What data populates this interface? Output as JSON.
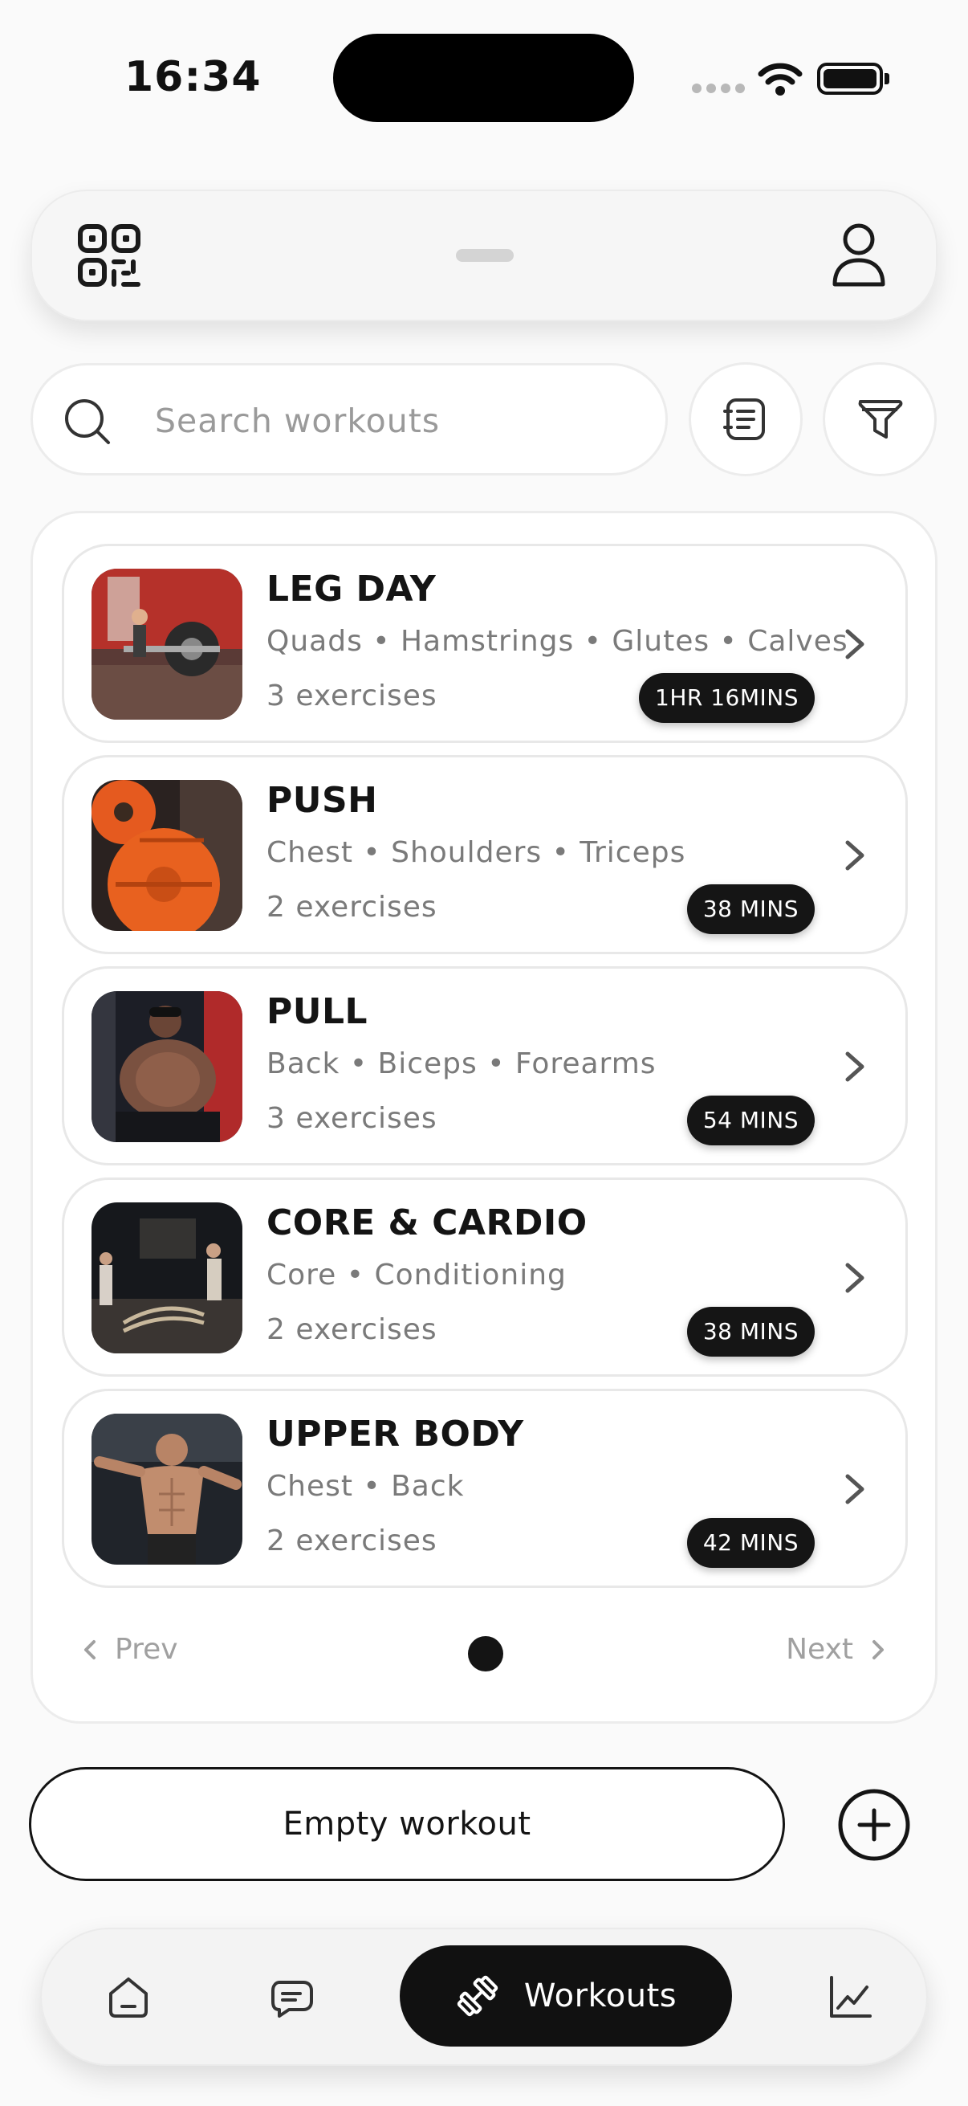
{
  "status_bar": {
    "time": "16:34"
  },
  "search": {
    "placeholder": "Search workouts"
  },
  "workouts": [
    {
      "title": "LEG DAY",
      "muscles": "Quads • Hamstrings • Glutes • Calves",
      "exercises": "3 exercises",
      "duration": "1HR 16MINS"
    },
    {
      "title": "PUSH",
      "muscles": "Chest • Shoulders • Triceps",
      "exercises": "2 exercises",
      "duration": "38 MINS"
    },
    {
      "title": "PULL",
      "muscles": "Back • Biceps • Forearms",
      "exercises": "3 exercises",
      "duration": "54 MINS"
    },
    {
      "title": "CORE & CARDIO",
      "muscles": "Core • Conditioning",
      "exercises": "2 exercises",
      "duration": "38 MINS"
    },
    {
      "title": "UPPER BODY",
      "muscles": "Chest • Back",
      "exercises": "2 exercises",
      "duration": "42 MINS"
    }
  ],
  "pager": {
    "prev_label": "Prev",
    "next_label": "Next"
  },
  "actions": {
    "empty_workout_label": "Empty workout"
  },
  "tab_bar": {
    "active_label": "Workouts"
  },
  "icons": {
    "top_left": "qr-code-icon",
    "top_right": "profile-icon",
    "search": "search-icon",
    "notes": "notes-icon",
    "filter": "filter-icon",
    "add": "plus-circle-icon",
    "tabs": [
      "home-icon",
      "chat-icon",
      "dumbbell-icon",
      "chart-icon"
    ]
  },
  "colors": {
    "accent": "#111111",
    "muted_text": "#7a7a7a",
    "background": "#fafafa"
  }
}
